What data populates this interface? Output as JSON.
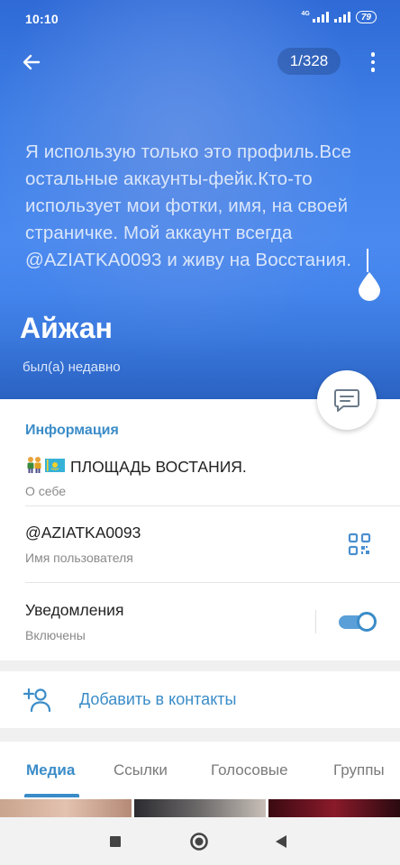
{
  "status_bar": {
    "time": "10:10",
    "network": "4G",
    "battery": "79"
  },
  "header": {
    "photo_counter": "1/328",
    "bio": "Я использую только это профиль.Все остальные аккаунты-фейк.Кто-то использует мои фотки, имя, на своей страничке. Мой аккаунт всегда @AZIATKA0093 и живу на Восстания.",
    "name": "Айжан",
    "last_seen": "был(а) недавно",
    "colors": {
      "background": "#3f7fe6"
    }
  },
  "info": {
    "title": "Информация",
    "about": {
      "value": "ПЛОЩАДЬ ВОСТАНИЯ.",
      "label": "О себе"
    },
    "username": {
      "value": "@AZIATKA0093",
      "label": "Имя пользователя"
    },
    "notifications": {
      "value": "Уведомления",
      "label": "Включены",
      "enabled": true
    }
  },
  "add_contact": {
    "label": "Добавить в контакты"
  },
  "tabs": [
    {
      "label": "Медиа",
      "active": true
    },
    {
      "label": "Ссылки",
      "active": false
    },
    {
      "label": "Голосовые",
      "active": false
    },
    {
      "label": "Группы",
      "active": false
    }
  ],
  "accent_color": "#3a8cc8",
  "icons": {
    "back": "arrow-left-icon",
    "menu": "more-vertical-icon",
    "message": "message-icon",
    "qr": "qr-code-icon",
    "add_contact": "add-person-icon",
    "nav": [
      "square-icon",
      "circle-icon",
      "triangle-back-icon"
    ]
  }
}
